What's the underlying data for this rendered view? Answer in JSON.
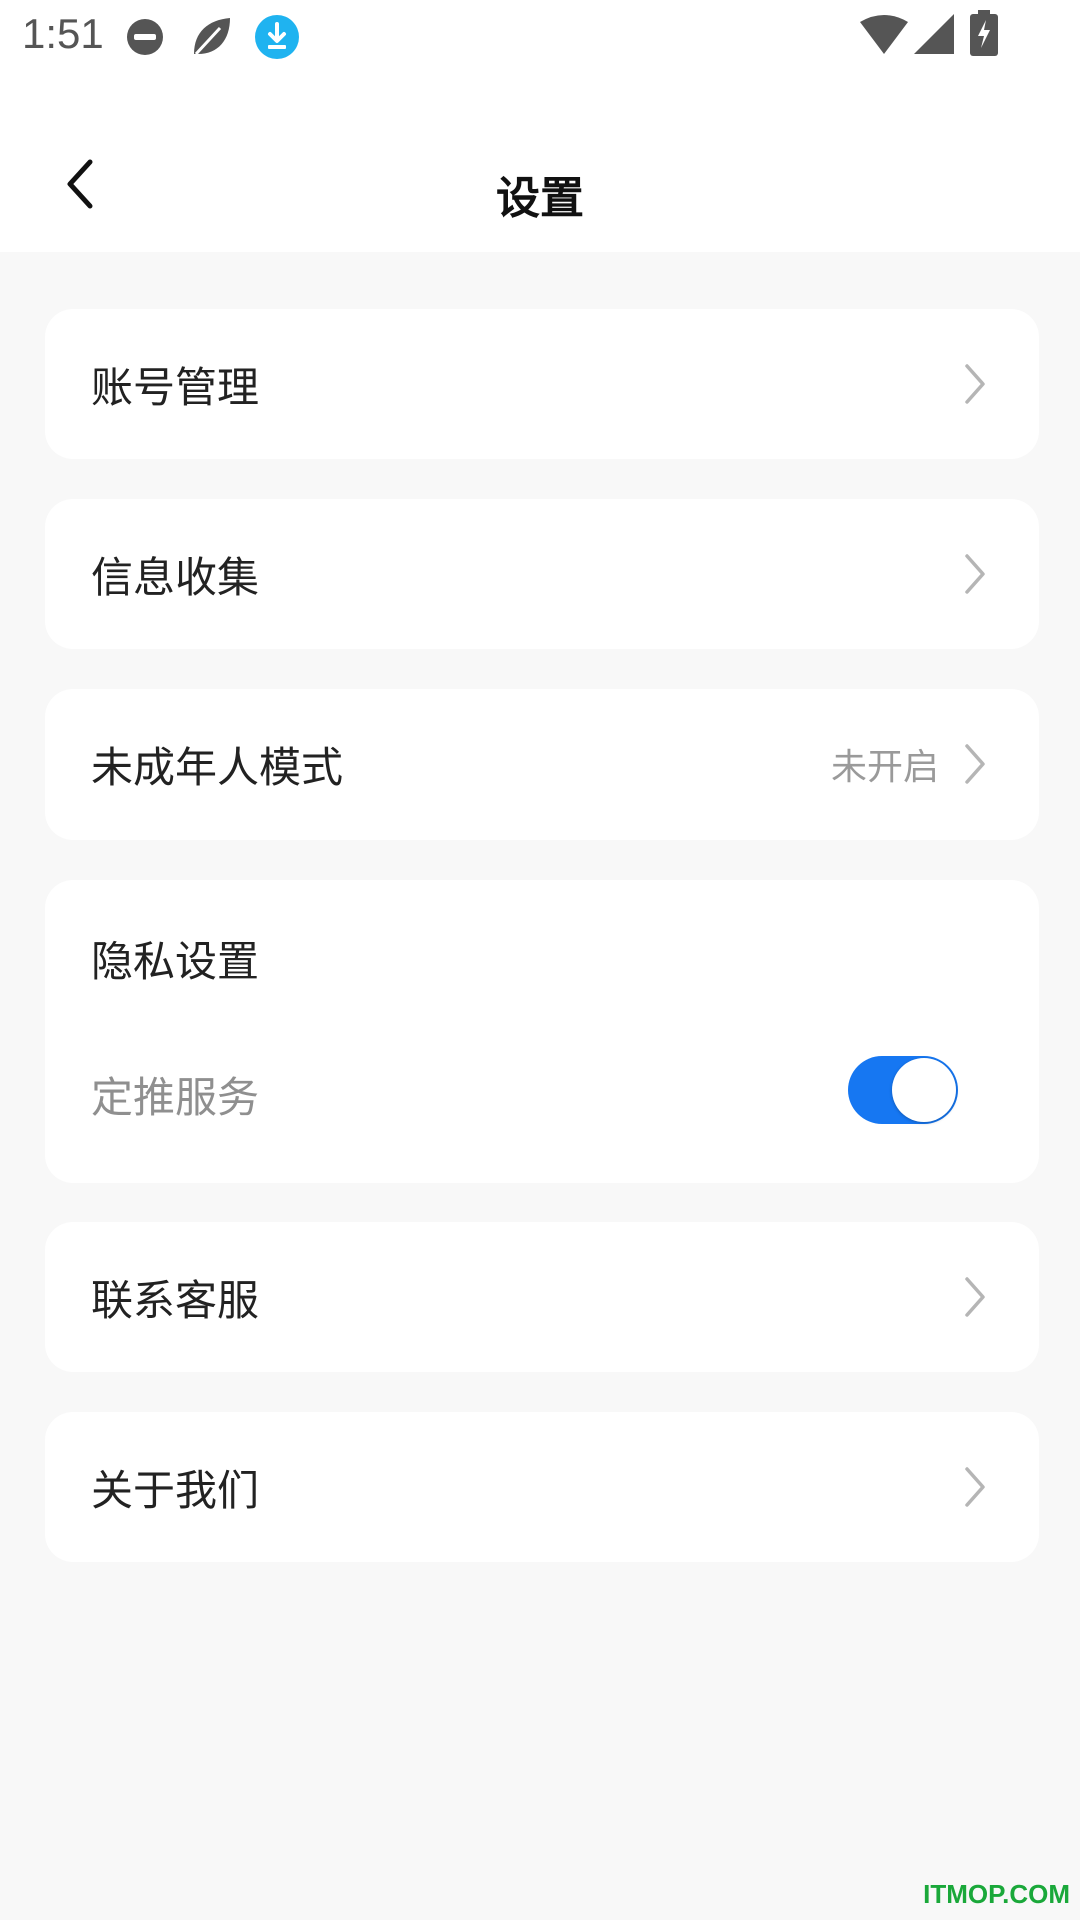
{
  "status_bar": {
    "time": "1:51",
    "icons": [
      "do-not-disturb-icon",
      "leaf-icon",
      "download-icon",
      "wifi-icon",
      "cell-signal-icon",
      "battery-charging-icon"
    ]
  },
  "header": {
    "title": "设置",
    "back_icon": "chevron-left-icon"
  },
  "settings": {
    "account": {
      "label": "账号管理"
    },
    "info_collection": {
      "label": "信息收集"
    },
    "minor_mode": {
      "label": "未成年人模式",
      "value": "未开启"
    },
    "privacy": {
      "title": "隐私设置",
      "push_label": "定推服务",
      "push_enabled": true
    },
    "contact": {
      "label": "联系客服"
    },
    "about": {
      "label": "关于我们"
    }
  },
  "colors": {
    "accent": "#1677f2",
    "background": "#f8f8f8",
    "card": "#ffffff",
    "download_icon": "#1fb3f0"
  },
  "watermark": "ITMOP.COM"
}
